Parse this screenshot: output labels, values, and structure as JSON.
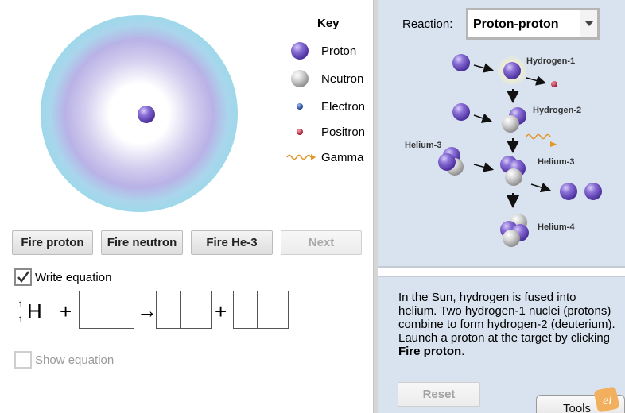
{
  "key": {
    "title": "Key",
    "items": [
      {
        "label": "Proton",
        "icon": "proton-icon",
        "color": "#7b5cc9"
      },
      {
        "label": "Neutron",
        "icon": "neutron-icon",
        "color": "#c8c8c8"
      },
      {
        "label": "Electron",
        "icon": "electron-icon",
        "color": "#1f4fa8"
      },
      {
        "label": "Positron",
        "icon": "positron-icon",
        "color": "#c8283b"
      },
      {
        "label": "Gamma",
        "icon": "gamma-wave-icon",
        "color": "#e3962a"
      }
    ]
  },
  "buttons": {
    "fire_proton": "Fire proton",
    "fire_neutron": "Fire neutron",
    "fire_he3": "Fire He-3",
    "next": "Next"
  },
  "equation": {
    "write_label": "Write equation",
    "write_checked": true,
    "mass_number": "1",
    "atomic_number": "1",
    "element": "H",
    "plus": "+",
    "arrow": "→",
    "show_label": "Show equation",
    "show_checked": false
  },
  "reaction": {
    "label": "Reaction:",
    "selected": "Proton-proton"
  },
  "diagram": {
    "labels": {
      "hydrogen1": "Hydrogen-1",
      "hydrogen2": "Hydrogen-2",
      "helium3_left": "Helium-3",
      "helium3_right": "Helium-3",
      "helium4": "Helium-4"
    }
  },
  "description": {
    "text": "In the Sun, hydrogen is fused into helium. Two hydrogen-1 nuclei (protons) combine to form hydrogen-2 (deuterium). Launch a proton at the target by clicking ",
    "bold": "Fire proton",
    "end": "."
  },
  "reset_label": "Reset",
  "tools_label": "Tools",
  "colors": {
    "target_outer": "#9ed8ea",
    "target_mid": "#b8b0e6",
    "panel_bg": "#d9e3ef"
  }
}
